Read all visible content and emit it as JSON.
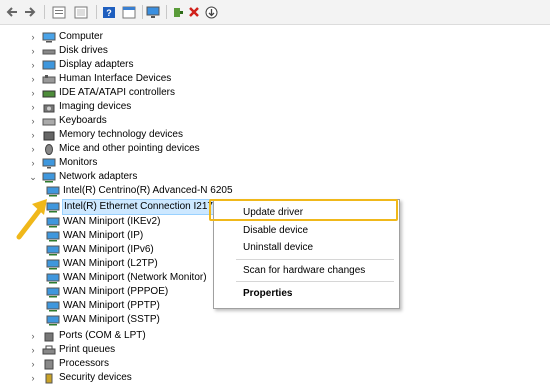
{
  "toolbar": {
    "buttons": [
      "back-arrow-icon",
      "forward-arrow-icon",
      "properties-icon",
      "view-icon",
      "help-icon",
      "panel-icon",
      "monitor-icon",
      "enable-device-icon",
      "uninstall-x-icon",
      "update-driver-icon"
    ]
  },
  "tree": {
    "categories_top": [
      {
        "label": "Computer",
        "icon": "computer-icon"
      },
      {
        "label": "Disk drives",
        "icon": "disk-icon"
      },
      {
        "label": "Display adapters",
        "icon": "display-icon"
      },
      {
        "label": "Human Interface Devices",
        "icon": "hid-icon"
      },
      {
        "label": "IDE ATA/ATAPI controllers",
        "icon": "ide-icon"
      },
      {
        "label": "Imaging devices",
        "icon": "camera-icon"
      },
      {
        "label": "Keyboards",
        "icon": "keyboard-icon"
      },
      {
        "label": "Memory technology devices",
        "icon": "memory-icon"
      },
      {
        "label": "Mice and other pointing devices",
        "icon": "mouse-icon"
      },
      {
        "label": "Monitors",
        "icon": "monitor-icon"
      }
    ],
    "network_adapters": {
      "label": "Network adapters",
      "children": [
        "Intel(R) Centrino(R) Advanced-N 6205",
        "Intel(R) Ethernet Connection I217-",
        "WAN Miniport (IKEv2)",
        "WAN Miniport (IP)",
        "WAN Miniport (IPv6)",
        "WAN Miniport (L2TP)",
        "WAN Miniport (Network Monitor)",
        "WAN Miniport (PPPOE)",
        "WAN Miniport (PPTP)",
        "WAN Miniport (SSTP)"
      ]
    },
    "categories_bottom": [
      {
        "label": "Ports (COM & LPT)",
        "icon": "port-icon"
      },
      {
        "label": "Print queues",
        "icon": "printer-icon"
      },
      {
        "label": "Processors",
        "icon": "processor-icon"
      },
      {
        "label": "Security devices",
        "icon": "security-icon"
      }
    ]
  },
  "context_menu": {
    "items": [
      {
        "label": "Update driver"
      },
      {
        "label": "Disable device"
      },
      {
        "label": "Uninstall device"
      },
      {
        "label": "Scan for hardware changes"
      },
      {
        "label": "Properties"
      }
    ]
  },
  "colors": {
    "highlight": "#f0b81a",
    "selection": "#cde8ff",
    "folder_blue": "#2f8fd8"
  }
}
